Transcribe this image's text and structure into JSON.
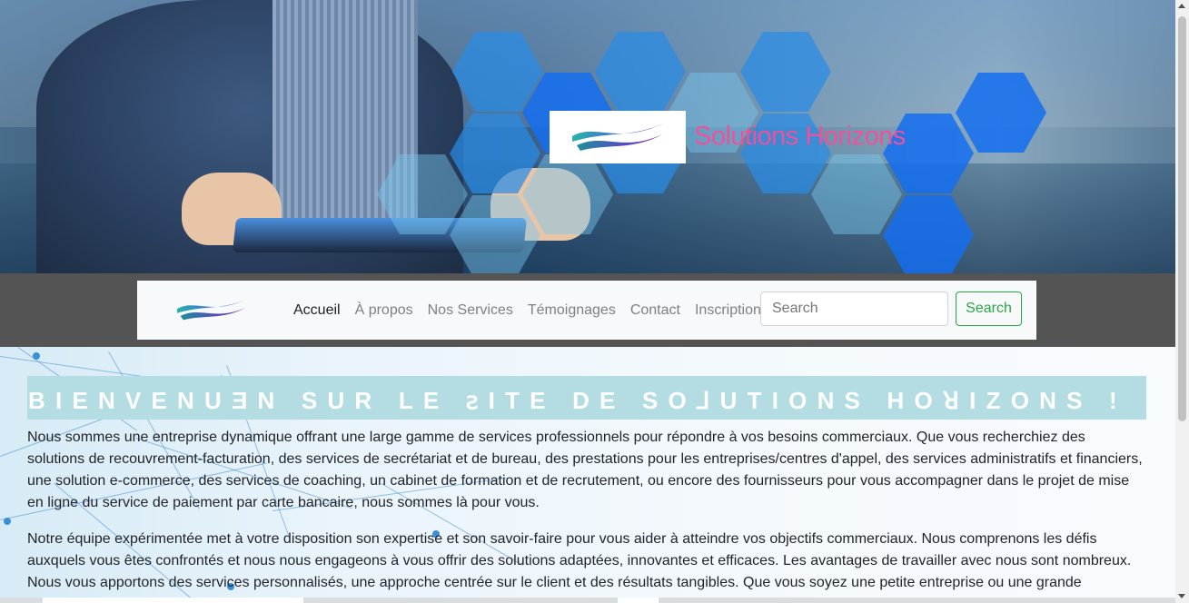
{
  "brand": {
    "title": "Solutions Horizons",
    "title_color": "#f2509a",
    "logo_icon": "wave-logo-icon"
  },
  "navbar": {
    "links": [
      {
        "label": "Accueil",
        "active": true
      },
      {
        "label": "À propos",
        "active": false
      },
      {
        "label": "Nos Services",
        "active": false
      },
      {
        "label": "Témoignages",
        "active": false
      },
      {
        "label": "Contact",
        "active": false
      },
      {
        "label": "Inscription",
        "active": false
      }
    ],
    "search_placeholder": "Search",
    "search_button": "Search",
    "accent_color": "#28a745"
  },
  "main": {
    "welcome_heading": "BIENVENUƎN SUR LE ꙅITE DE SO⅃UTIONS HOꓤIZONS !",
    "paragraph1": "Nous sommes une entreprise dynamique offrant une large gamme de services professionnels pour répondre à vos besoins commerciaux. Que vous recherchiez des solutions de recouvrement-facturation, des services de secrétariat et de bureau, des prestations pour les entreprises/centres d'appel, des services administratifs et financiers, une solution e-commerce, des services de coaching, un cabinet de formation et de recrutement, ou encore des fournisseurs pour vous accompagner dans le projet de mise en ligne du service de paiement par carte bancaire, nous sommes là pour vous.",
    "paragraph2": "Notre équipe expérimentée met à votre disposition son expertise et son savoir-faire pour vous aider à atteindre vos objectifs commerciaux. Nous comprenons les défis auxquels vous êtes confrontés et nous nous engageons à vous offrir des solutions adaptées, innovantes et efficaces. Les avantages de travailler avec nous sont nombreux. Nous vous apportons des services personnalisés, une approche centrée sur le client et des résultats tangibles. Que vous soyez une petite entreprise ou une grande"
  }
}
